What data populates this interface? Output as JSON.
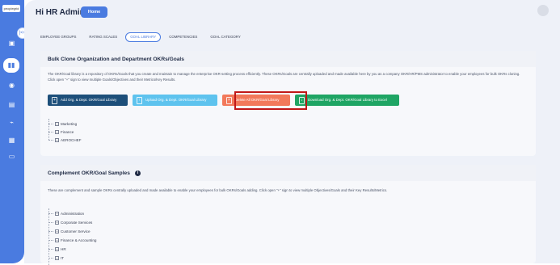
{
  "sidebar": {
    "logo_text": "peoplegrid",
    "collapse_symbol": "|<<"
  },
  "header": {
    "greeting": "Hi HR Admin",
    "home_label": "Home"
  },
  "tabs": [
    {
      "label": "EMPLOYEE GROUPS"
    },
    {
      "label": "RATING SCALES"
    },
    {
      "label": "GOAL LIBRARY"
    },
    {
      "label": "COMPETENCIES"
    },
    {
      "label": "GOAL CATEGORY"
    }
  ],
  "bulk_clone": {
    "title": "Bulk Clone Organization and Department OKRs/Goals",
    "description": "The OKR/Goal library is a repository of OKRs/Goals that you create and maintain to manage the enterprise OKR-setting process efficiently. These OKRs/Goals are centrally uploaded and made available here by you as a company OKR/HR/PMS administrator to enable your employees for bulk OKRs cloning. Click open \"+\" sign to view multiple Goals/Objectives and their Metrics/Key Results.",
    "buttons": {
      "add": "Add Org. & Dept. OKR/Goal Library",
      "upload": "Upload Org. & Dept. OKR/Goal Library",
      "delete": "Delete All OKR/Goal Library",
      "download": "Download Org. & Dept. OKR/Goal Library to Excel"
    },
    "tree": [
      "Marketing",
      "Finance",
      "AEROCHEF"
    ]
  },
  "complement": {
    "title": "Complement OKR/Goal Samples",
    "description": "These are complement and sample OKRs centrally uploaded and made available to enable your employees for bulk OKRs/Goals adding. Click open \"+\" sign to view multiple Objectives/Goals and their Key Results/Metrics.",
    "tree": [
      "Administration",
      "Corporate Services",
      "Customer Service",
      "Finance & Accounting",
      "HR",
      "IT"
    ]
  },
  "colors": {
    "accent": "#4a7be0",
    "navy_button": "#1d4f7a",
    "sky_button": "#5ec3ee",
    "coral_button": "#f2795b",
    "green_button": "#1fa564",
    "highlight": "#c01818"
  }
}
